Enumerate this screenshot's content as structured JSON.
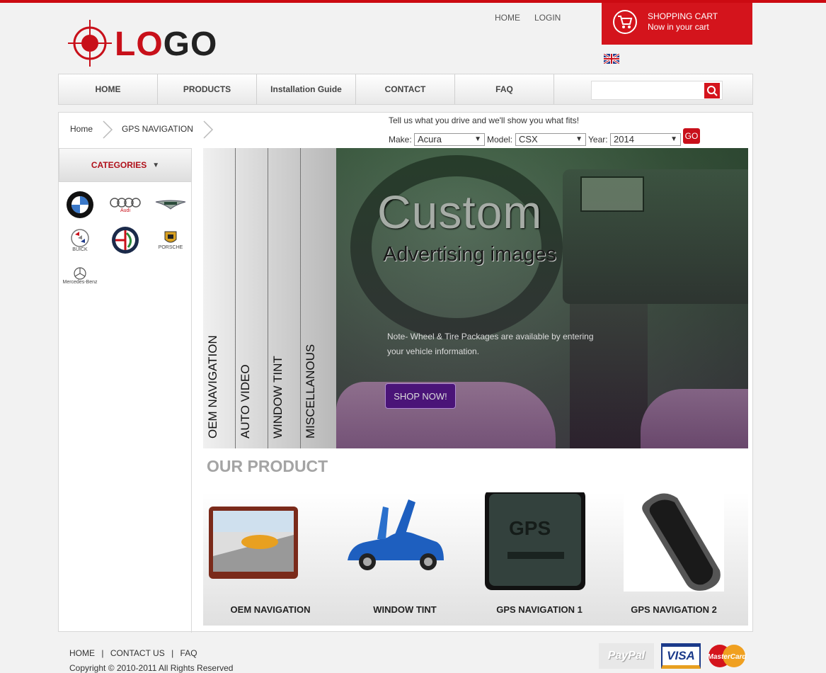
{
  "header": {
    "logo_lo": "LO",
    "logo_go": "GO",
    "top_links": [
      "HOME",
      "LOGIN"
    ],
    "cart_title": "SHOPPING CART",
    "cart_sub": "Now in your cart",
    "language_flag": "uk-flag-icon"
  },
  "nav": {
    "items": [
      "HOME",
      "PRODUCTS",
      "Installation Guide",
      "CONTACT",
      "FAQ"
    ],
    "search_placeholder": "",
    "search_icon": "search-icon"
  },
  "breadcrumb": [
    "Home",
    "GPS NAVIGATION"
  ],
  "vehicle": {
    "prompt": "Tell us what you drive and we'll show you what fits!",
    "make_label": "Make:",
    "make_value": "Acura",
    "model_label": "Model:",
    "model_value": "CSX",
    "year_label": "Year:",
    "year_value": "2014",
    "go_label": "GO"
  },
  "categories": {
    "heading": "CATEGORIES",
    "brands": [
      "BMW",
      "Audi",
      "Aston Martin",
      "BUICK",
      "Alfa Romeo",
      "PORSCHE",
      "Mercedes-Benz"
    ]
  },
  "banner": {
    "tabs": [
      "OEM NAVIGATION",
      "AUTO VIDEO",
      "WINDOW TINT",
      "MISCELLANOUS"
    ],
    "title": "Custom",
    "subtitle": "Advertising images",
    "note": "Note- Wheel & Tire Packages are available by entering your vehicle information.",
    "button": "SHOP NOW!"
  },
  "products": {
    "heading": "OUR PRODUCT",
    "items": [
      "OEM NAVIGATION",
      "WINDOW TINT",
      "GPS NAVIGATION 1",
      "GPS NAVIGATION 2"
    ],
    "gps_box_text": "GPS"
  },
  "footer": {
    "links": [
      "HOME",
      "CONTACT US",
      "FAQ"
    ],
    "separator": "|",
    "copyright": "Copyright © 2010-2011 All Rights Reserved",
    "payments": [
      "PayPal",
      "VISA",
      "MasterCard"
    ]
  },
  "colors": {
    "brand_red": "#d4141c",
    "nav_bg": "#e8e8e8",
    "button_purple": "#4a1478"
  }
}
